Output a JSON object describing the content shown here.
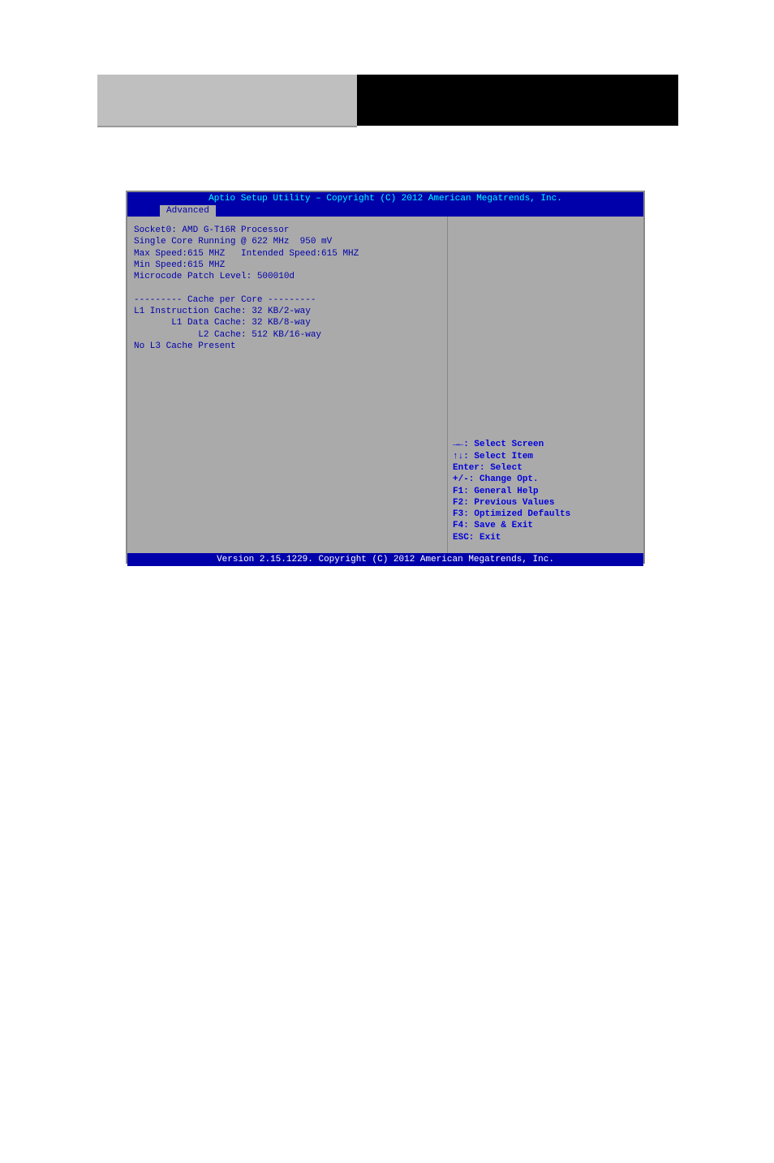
{
  "bios": {
    "title": "Aptio Setup Utility – Copyright (C) 2012 American Megatrends, Inc.",
    "tab": "Advanced",
    "info": {
      "line1": "Socket0: AMD G-T16R Processor",
      "line2": "Single Core Running @ 622 MHz  950 mV",
      "line3": "Max Speed:615 MHZ   Intended Speed:615 MHZ",
      "line4": "Min Speed:615 MHZ",
      "line5": "Microcode Patch Level: 500010d",
      "line6": "--------- Cache per Core ---------",
      "line7": "L1 Instruction Cache: 32 KB/2-way",
      "line8": "       L1 Data Cache: 32 KB/8-way",
      "line9": "            L2 Cache: 512 KB/16-way",
      "line10": "No L3 Cache Present"
    },
    "help": {
      "h1": "→←: Select Screen",
      "h2": "↑↓: Select Item",
      "h3": "Enter: Select",
      "h4": "+/-: Change Opt.",
      "h5": "F1: General Help",
      "h6": "F2: Previous Values",
      "h7": "F3: Optimized Defaults",
      "h8": "F4: Save & Exit",
      "h9": "ESC: Exit"
    },
    "footer": "Version 2.15.1229. Copyright (C) 2012 American Megatrends, Inc."
  }
}
